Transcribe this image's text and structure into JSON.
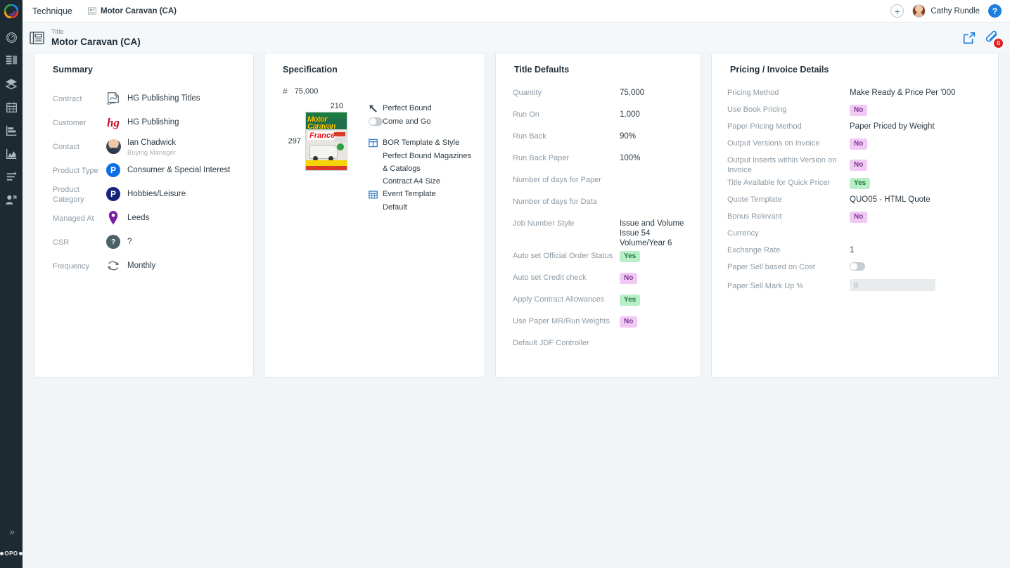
{
  "app": {
    "brand": "Technique",
    "breadcrumb": "Motor Caravan (CA)",
    "logo_icon": "swirl-logo-icon",
    "rail_brand": "OPO"
  },
  "topbar": {
    "add_label": "+",
    "user_name": "Cathy Rundle",
    "help_label": "?"
  },
  "title_header": {
    "kicker": "Title",
    "name": "Motor Caravan (CA)",
    "attachment_count": "0"
  },
  "summary": {
    "heading": "Summary",
    "rows": [
      {
        "label": "Contract",
        "value": "HG Publishing Titles",
        "sub": "",
        "icon": "contract-signature-icon"
      },
      {
        "label": "Customer",
        "value": "HG Publishing",
        "sub": "",
        "icon": "hg-logo-icon"
      },
      {
        "label": "Contact",
        "value": "Ian Chadwick",
        "sub": "Buying Manager",
        "icon": "contact-avatar-icon"
      },
      {
        "label": "Product Type",
        "value": "Consumer & Special Interest",
        "sub": "",
        "icon": "product-type-icon"
      },
      {
        "label": "Product Category",
        "value": "Hobbies/Leisure",
        "sub": "",
        "icon": "product-category-icon"
      },
      {
        "label": "Managed At",
        "value": "Leeds",
        "sub": "",
        "icon": "location-pin-icon"
      },
      {
        "label": "CSR",
        "value": "?",
        "sub": "",
        "icon": "csr-unknown-icon"
      },
      {
        "label": "Frequency",
        "value": "Monthly",
        "sub": "",
        "icon": "recurrence-icon"
      }
    ]
  },
  "specification": {
    "heading": "Specification",
    "pagination_count": "75,000",
    "width": "210",
    "height": "297",
    "cover": {
      "title_line1": "Motor",
      "title_line2": "Caravan",
      "headline": "France"
    },
    "binding": "Perfect Bound",
    "come_and_go_label": "Come and Go",
    "come_and_go_on": false,
    "bor_template_label": "BOR Template & Style",
    "bor_template_value1": "Perfect Bound Magazines & Catalogs",
    "bor_template_value2": "Contract A4 Size",
    "event_template_label": "Event Template",
    "event_template_value": "Default"
  },
  "title_defaults": {
    "heading": "Title Defaults",
    "rows": [
      {
        "label": "Quantity",
        "value": "75,000",
        "type": "text"
      },
      {
        "label": "Run On",
        "value": "1,000",
        "type": "text"
      },
      {
        "label": "Run Back",
        "value": "90%",
        "type": "text"
      },
      {
        "label": "Run Back Paper",
        "value": "100%",
        "type": "text"
      },
      {
        "label": "Number of days for Paper",
        "value": "",
        "type": "text"
      },
      {
        "label": "Number of days for Data",
        "value": "",
        "type": "text"
      },
      {
        "label": "Job Number Style",
        "value": "Issue and Volume\nIssue 54\nVolume/Year 6",
        "type": "multiline"
      },
      {
        "label": "Auto set Official Order Status",
        "value": "Yes",
        "type": "badge-yes"
      },
      {
        "label": "Auto set Credit check",
        "value": "No",
        "type": "badge-no"
      },
      {
        "label": "Apply Contract Allowances",
        "value": "Yes",
        "type": "badge-yes"
      },
      {
        "label": "Use Paper MR/Run Weights",
        "value": "No",
        "type": "badge-no"
      },
      {
        "label": "Default JDF Controller",
        "value": "",
        "type": "text"
      }
    ]
  },
  "pricing": {
    "heading": "Pricing / Invoice Details",
    "rows": [
      {
        "label": "Pricing Method",
        "value": "Make Ready & Price Per '000",
        "type": "text"
      },
      {
        "label": "Use Book Pricing",
        "value": "No",
        "type": "badge-no"
      },
      {
        "label": "Paper Pricing Method",
        "value": "Paper Priced by Weight",
        "type": "text"
      },
      {
        "label": "Output Versions on Invoice",
        "value": "No",
        "type": "badge-no"
      },
      {
        "label": "Output Inserts within Version on Invoice",
        "value": "No",
        "type": "badge-no"
      },
      {
        "label": "Title Available for Quick Pricer",
        "value": "Yes",
        "type": "badge-yes"
      },
      {
        "label": "Quote Template",
        "value": "QUO05 - HTML Quote",
        "type": "text"
      },
      {
        "label": "Bonus Relevant",
        "value": "No",
        "type": "badge-no"
      },
      {
        "label": "Currency",
        "value": "",
        "type": "text"
      },
      {
        "label": "Exchange Rate",
        "value": "1",
        "type": "text"
      },
      {
        "label": "Paper Sell based on Cost",
        "value": "",
        "type": "toggle"
      },
      {
        "label": "Paper Sell Mark Up %",
        "value": "0",
        "type": "input"
      }
    ]
  },
  "sidebar": {
    "items": [
      {
        "name": "dashboard",
        "icon": "gauge-icon"
      },
      {
        "name": "layout",
        "icon": "layout-list-icon"
      },
      {
        "name": "layers",
        "icon": "layers-icon"
      },
      {
        "name": "calendar",
        "icon": "calendar-icon"
      },
      {
        "name": "reports",
        "icon": "bar-chart-icon"
      },
      {
        "name": "analytics",
        "icon": "area-chart-icon"
      },
      {
        "name": "new-entry",
        "icon": "list-plus-icon"
      },
      {
        "name": "handover",
        "icon": "user-arrow-icon"
      }
    ],
    "expand_label": "»"
  },
  "colors": {
    "rail_bg": "#1e2a31",
    "page_bg": "#f2f5f8",
    "accent_blue": "#1e7ee0",
    "badge_yes_bg": "#b9efc8",
    "badge_no_bg": "#f0c9f5",
    "alert_red": "#e02020"
  }
}
